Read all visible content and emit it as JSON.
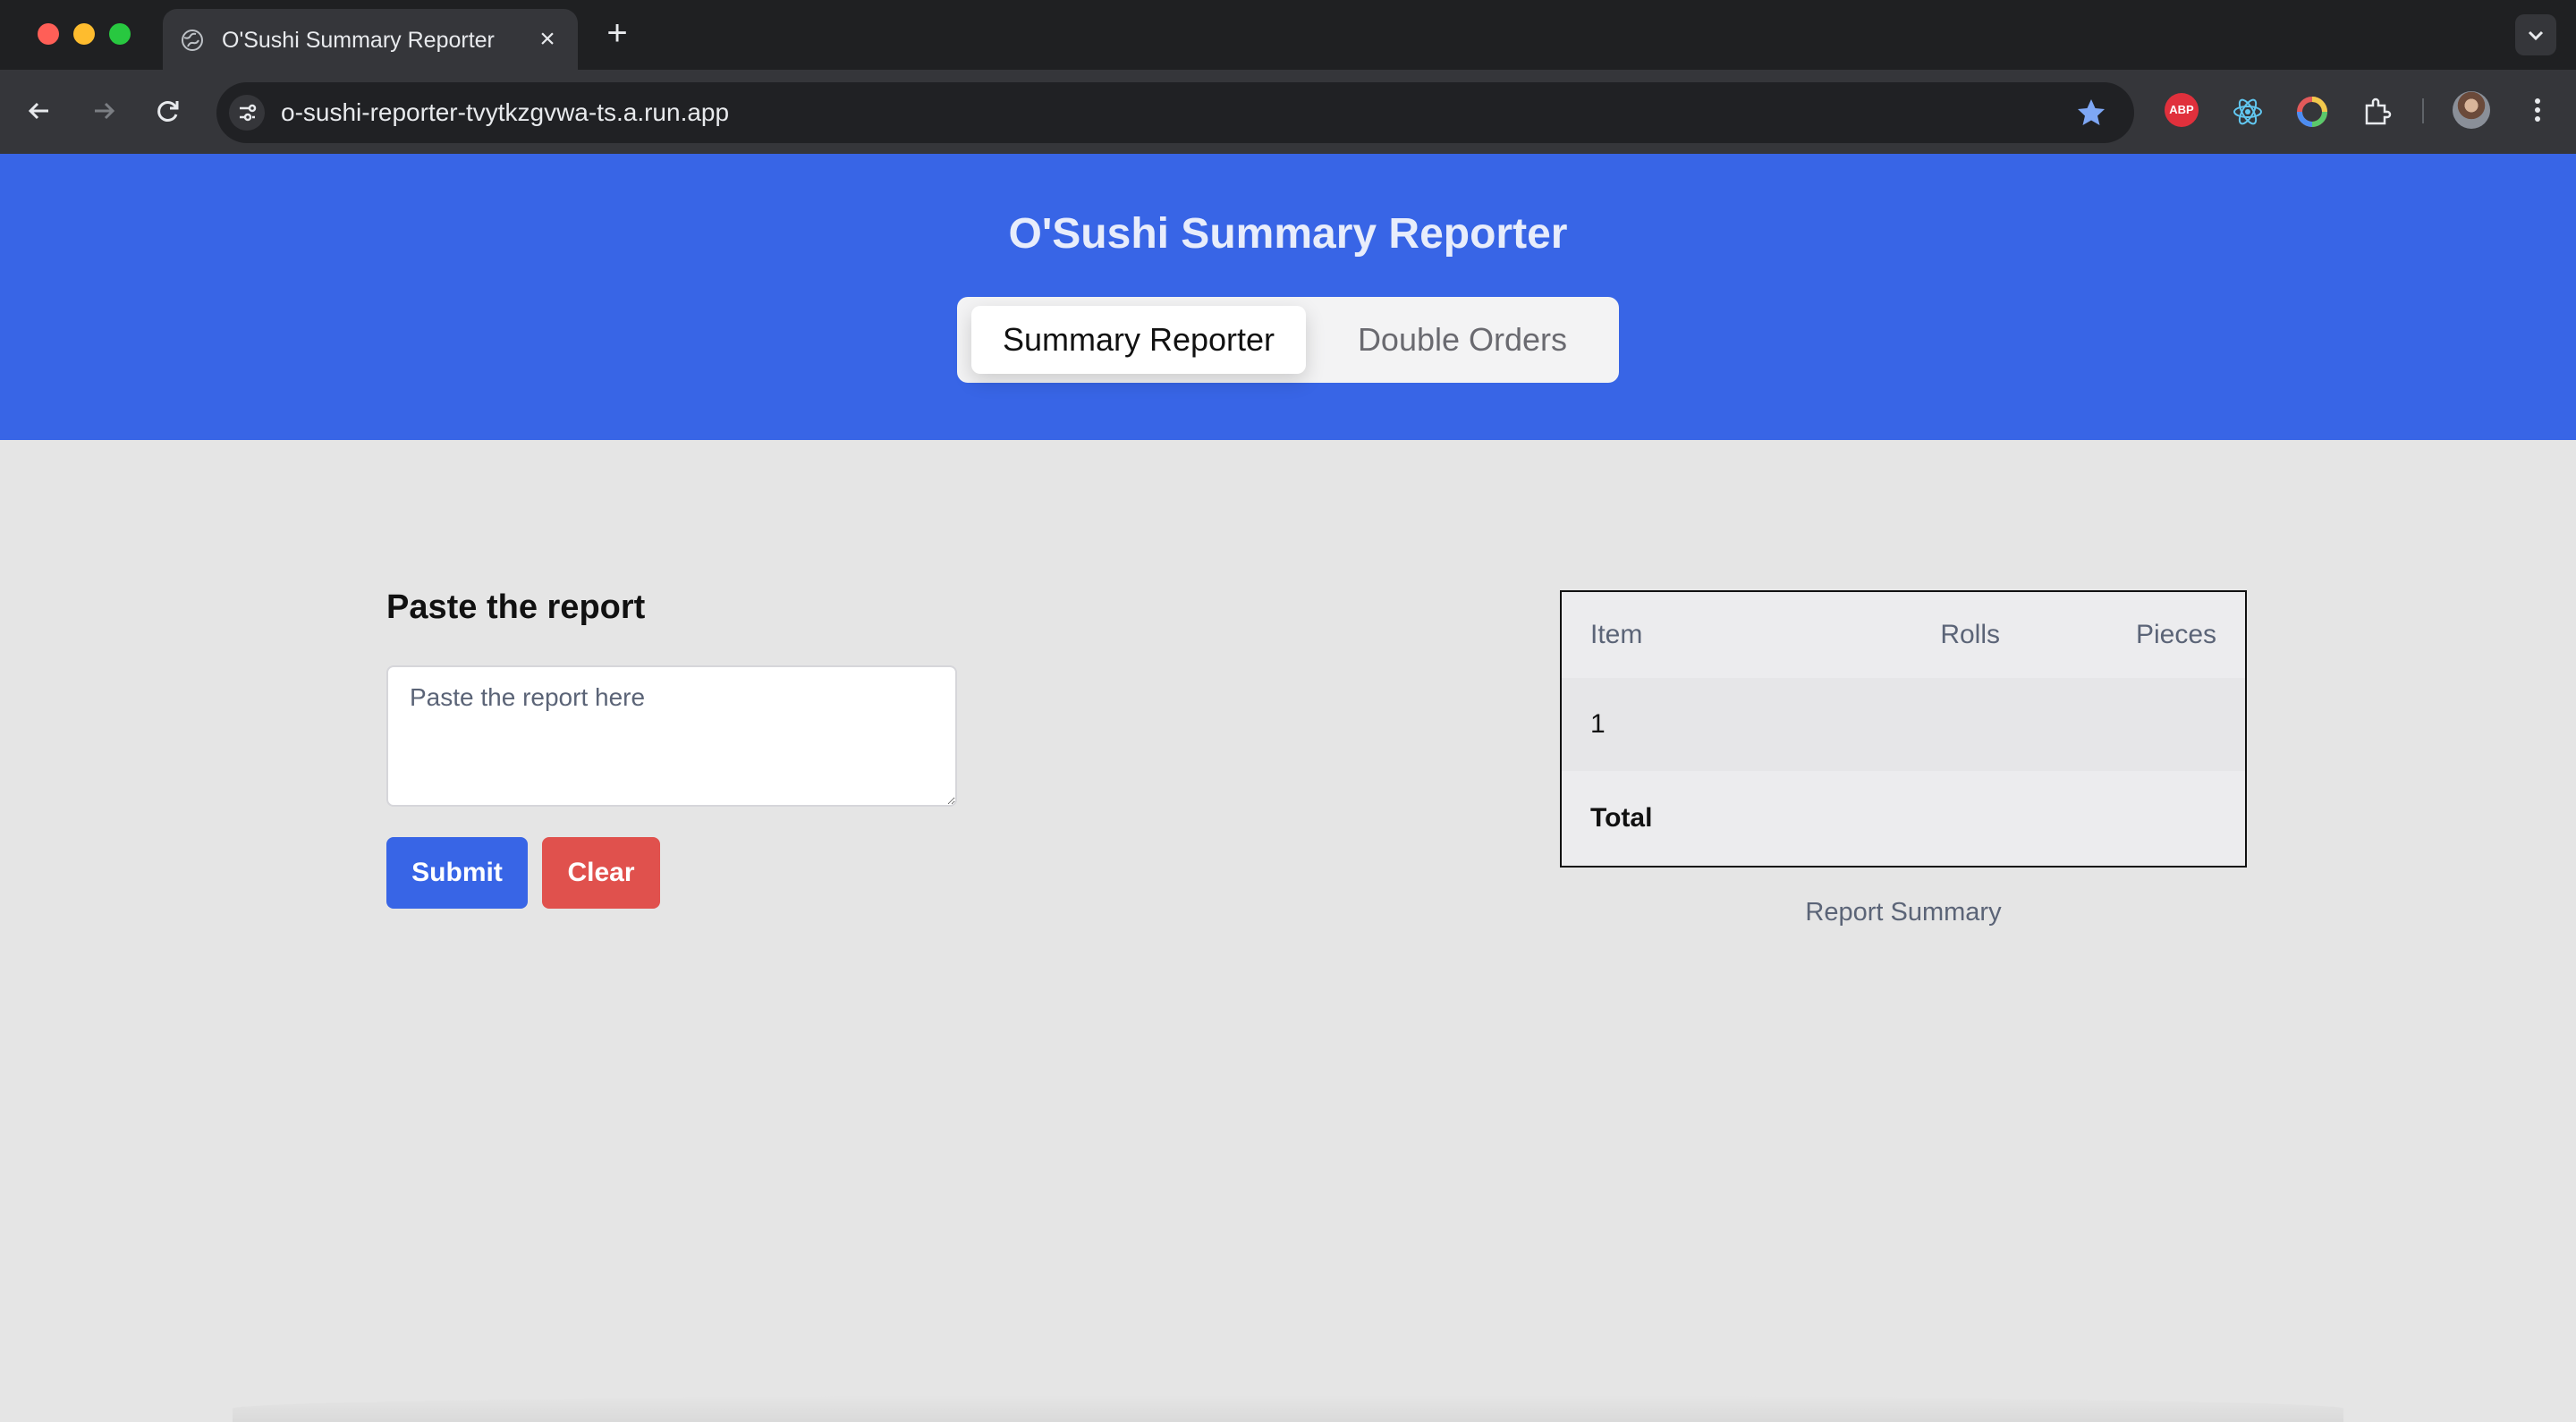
{
  "browser": {
    "tab_title": "O'Sushi Summary Reporter",
    "tab_close": "×",
    "new_tab": "+",
    "url": "o-sushi-reporter-tvytkzgvwa-ts.a.run.app",
    "abp_label": "ABP",
    "icons": [
      "back-icon",
      "forward-icon",
      "reload-icon",
      "site-info-icon",
      "star-icon",
      "adblock-icon",
      "react-devtools-icon",
      "color-picker-icon",
      "extensions-icon",
      "profile-avatar",
      "menu-icon"
    ]
  },
  "header": {
    "title": "O'Sushi Summary Reporter",
    "tabs": [
      {
        "label": "Summary Reporter",
        "active": true
      },
      {
        "label": "Double Orders",
        "active": false
      }
    ]
  },
  "form": {
    "heading": "Paste the report",
    "placeholder": "Paste the report here",
    "value": "",
    "submit_label": "Submit",
    "clear_label": "Clear"
  },
  "summary": {
    "columns": [
      "Item",
      "Rolls",
      "Pieces"
    ],
    "rows": [
      {
        "item": "1",
        "rolls": "",
        "pieces": ""
      }
    ],
    "total": {
      "item": "Total",
      "rolls": "",
      "pieces": ""
    },
    "caption": "Report Summary"
  },
  "colors": {
    "header_bg": "#3865e6",
    "page_bg": "#e5e5e5",
    "submit": "#3865e6",
    "clear": "#e0514d"
  }
}
